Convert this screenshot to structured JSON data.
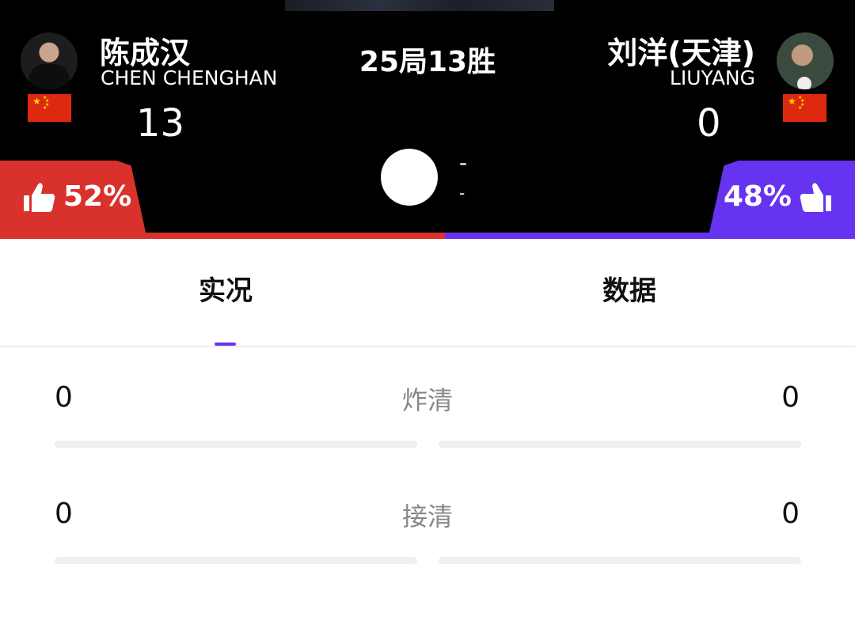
{
  "match": {
    "title": "25局13胜"
  },
  "players": {
    "left": {
      "name_cn": "陈成汉",
      "name_en": "CHEN CHENGHAN",
      "score": "13",
      "support_pct": "52%",
      "flag": "china-flag",
      "color": "#d9312b"
    },
    "right": {
      "name_cn": "刘洋(天津)",
      "name_en": "LIUYANG",
      "score": "0",
      "support_pct": "48%",
      "flag": "china-flag",
      "color": "#6633f0"
    }
  },
  "break_info": {
    "line1": "-",
    "line2": "-"
  },
  "tabs": [
    {
      "label": "实况",
      "active": true
    },
    {
      "label": "数据",
      "active": false
    }
  ],
  "stats": [
    {
      "label": "炸清",
      "left": "0",
      "right": "0"
    },
    {
      "label": "接清",
      "left": "0",
      "right": "0"
    }
  ],
  "colors": {
    "accent": "#6633f0",
    "left_team": "#d9312b",
    "right_team": "#6633f0",
    "header_bg": "#000000"
  }
}
